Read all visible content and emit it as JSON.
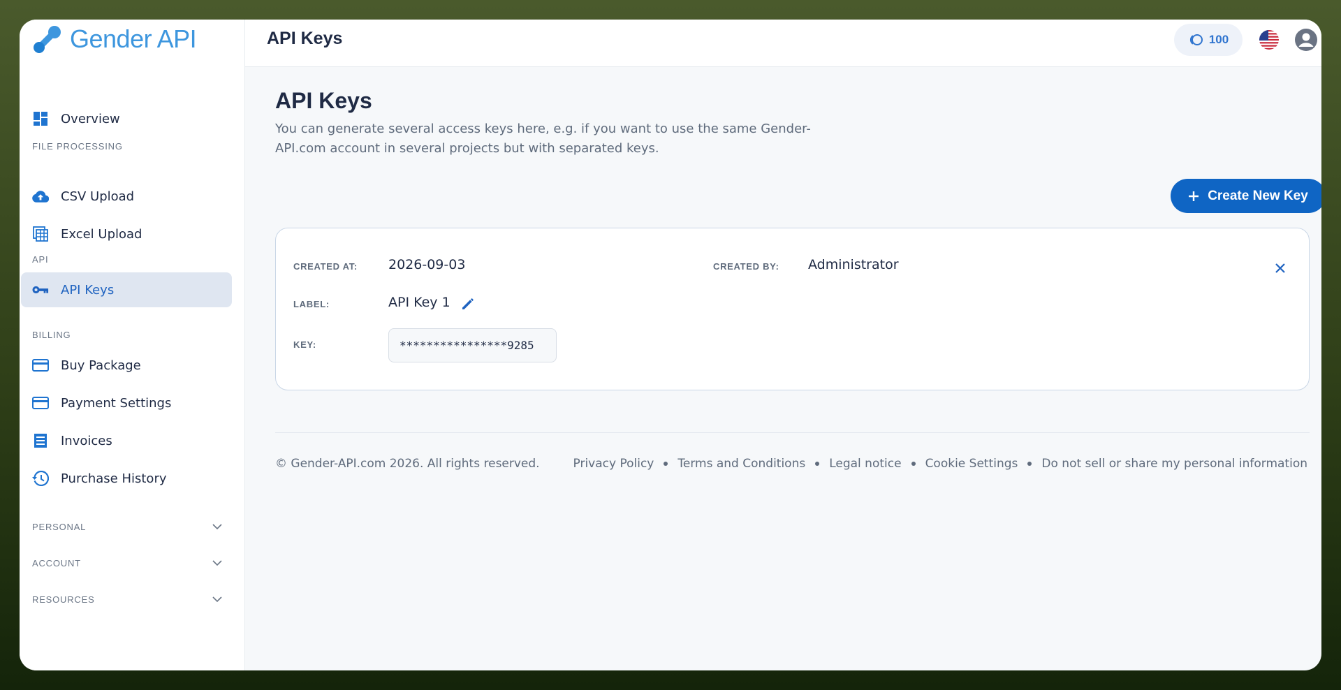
{
  "app": {
    "logo_text": "Gender API",
    "colors": {
      "brand": "#3d96de",
      "accent": "#0f65c4",
      "active_bg": "#dfe6f1"
    }
  },
  "sidebar": {
    "overview": {
      "label": "Overview",
      "icon": "dashboard-icon"
    },
    "sections": [
      {
        "label": "FILE PROCESSING"
      },
      {
        "label": "API"
      },
      {
        "label": "BILLING"
      }
    ],
    "items": [
      {
        "label": "CSV Upload",
        "icon": "cloud-upload-icon"
      },
      {
        "label": "Excel Upload",
        "icon": "spreadsheet-icon"
      },
      {
        "label": "API Keys",
        "icon": "key-icon",
        "active": true
      },
      {
        "label": "Buy Package",
        "icon": "credit-card-icon"
      },
      {
        "label": "Payment Settings",
        "icon": "credit-card-icon"
      },
      {
        "label": "Invoices",
        "icon": "receipt-icon"
      },
      {
        "label": "Purchase History",
        "icon": "history-icon"
      }
    ],
    "collapsible": [
      {
        "label": "PERSONAL"
      },
      {
        "label": "ACCOUNT"
      },
      {
        "label": "RESOURCES"
      }
    ]
  },
  "topbar": {
    "title": "API Keys",
    "credits": "100"
  },
  "main": {
    "title": "API Keys",
    "description": "You can generate several access keys here, e.g. if you want to use the same Gender-API.com account in several projects but with separated keys.",
    "create_button": "Create New Key",
    "key_card": {
      "created_at_label": "CREATED AT:",
      "created_at": "2026-09-03",
      "created_by_label": "CREATED BY:",
      "created_by": "Administrator",
      "label_label": "LABEL:",
      "label": "API Key 1",
      "key_label": "KEY:",
      "key": "****************9285"
    }
  },
  "footer": {
    "copyright": "© Gender-API.com 2026. All rights reserved.",
    "links": [
      "Privacy Policy",
      "Terms and Conditions",
      "Legal notice",
      "Cookie Settings",
      "Do not sell or share my personal information"
    ]
  }
}
